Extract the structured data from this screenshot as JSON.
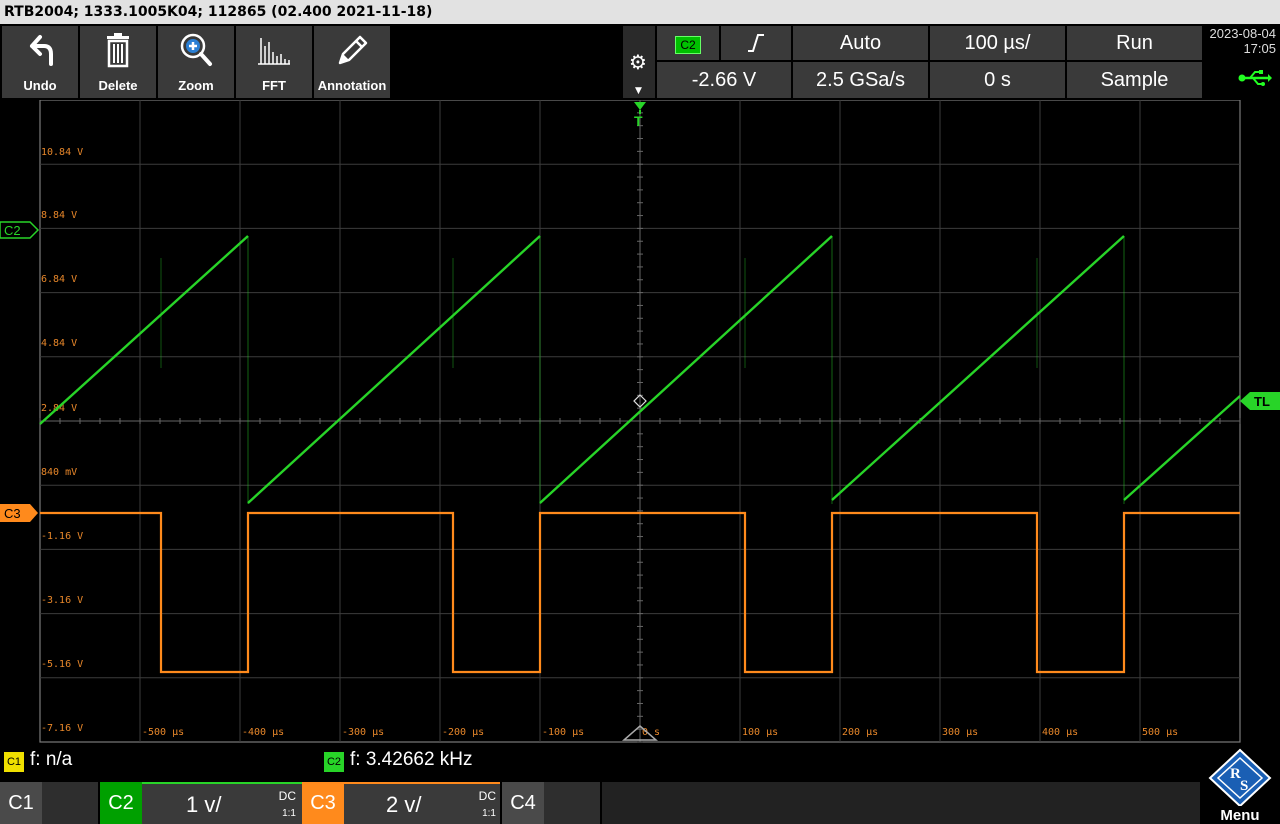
{
  "title": "RTB2004; 1333.1005K04; 112865 (02.400 2021-11-18)",
  "toolbar": {
    "undo": "Undo",
    "delete": "Delete",
    "zoom": "Zoom",
    "fft": "FFT",
    "annotation": "Annotation"
  },
  "trigger_panel": {
    "source": "C2",
    "mode": "Auto",
    "timebase": "100 µs/",
    "run_state": "Run",
    "level": "-2.66 V",
    "sample_rate": "2.5 GSa/s",
    "position": "0 s",
    "acquisition": "Sample"
  },
  "datetime": {
    "date": "2023-08-04",
    "time": "17:05"
  },
  "display": {
    "colors": {
      "ch2": "#28d428",
      "ch3": "#ff8a1c",
      "grid": "#3c3c3c",
      "axis_label": "#e8872a"
    },
    "y_labels": [
      "10.84 V",
      "8.84 V",
      "6.84 V",
      "4.84 V",
      "2.84 V",
      "840 mV",
      "-1.16 V",
      "-3.16 V",
      "-5.16 V",
      "-7.16 V"
    ],
    "x_labels": [
      "-500 µs",
      "-400 µs",
      "-300 µs",
      "-200 µs",
      "-100 µs",
      "0 s",
      "100 µs",
      "200 µs",
      "300 µs",
      "400 µs",
      "500 µs"
    ],
    "marker_c2": "C2",
    "marker_c3": "C3",
    "marker_tl": "TL",
    "marker_t": "T"
  },
  "measurements": {
    "c1_badge": "C1",
    "c1_text": "f: n/a",
    "c2_badge": "C2",
    "c2_text": "f: 3.42662 kHz"
  },
  "channels": {
    "c1": {
      "name": "C1"
    },
    "c2": {
      "name": "C2",
      "scale": "1 v/",
      "coupling": "DC",
      "probe": "1:1"
    },
    "c3": {
      "name": "C3",
      "scale": "2 v/",
      "coupling": "DC",
      "probe": "1:1"
    },
    "c4": {
      "name": "C4"
    }
  },
  "menu": {
    "label": "Menu"
  }
}
